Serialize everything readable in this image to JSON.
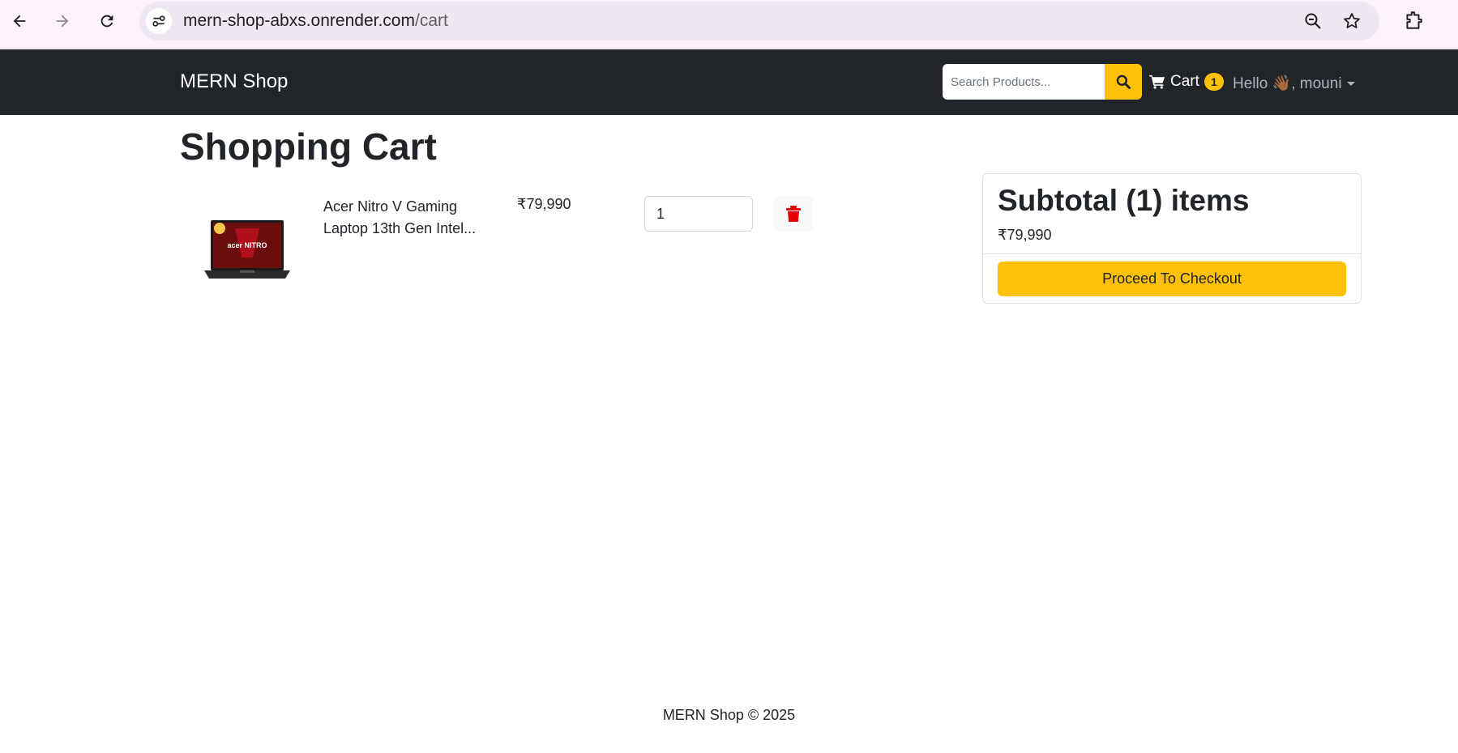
{
  "browser": {
    "url_host": "mern-shop-abxs.onrender.com",
    "url_path": "/cart",
    "icons": [
      "back-arrow-icon",
      "forward-arrow-icon",
      "reload-icon",
      "site-info-icon",
      "zoom-out-icon",
      "bookmark-star-icon",
      "extensions-icon"
    ]
  },
  "navbar": {
    "brand": "MERN Shop",
    "search_placeholder": "Search Products...",
    "cart_label": "Cart",
    "cart_count": "1",
    "greeting": "Hello 👋🏾, mouni"
  },
  "page": {
    "title": "Shopping Cart"
  },
  "cart": {
    "items": [
      {
        "name": "Acer Nitro V Gaming Laptop 13th Gen Intel...",
        "price": "₹79,990",
        "quantity": "1",
        "image_label": "acer NITRO"
      }
    ]
  },
  "summary": {
    "title": "Subtotal (1) items",
    "price": "₹79,990",
    "checkout_label": "Proceed To Checkout"
  },
  "footer": {
    "text": "MERN Shop © 2025"
  },
  "colors": {
    "navbar_bg": "#212529",
    "accent": "#ffc107",
    "danger": "#e60000"
  }
}
